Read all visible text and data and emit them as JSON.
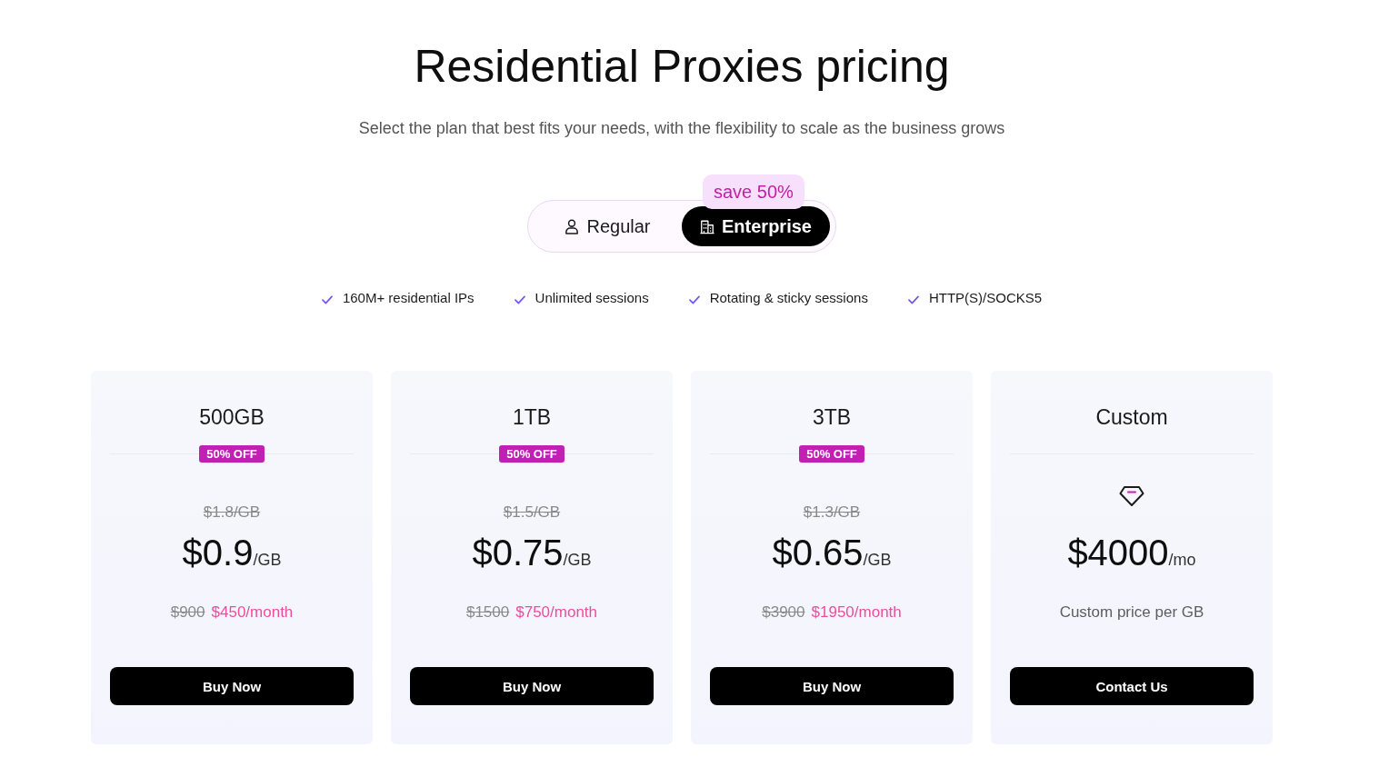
{
  "header": {
    "title": "Residential Proxies pricing",
    "subtitle": "Select the plan that best fits your needs, with the flexibility to scale as the business grows"
  },
  "plan_toggle": {
    "badge": "save 50%",
    "options": [
      {
        "label": "Regular",
        "selected": false
      },
      {
        "label": "Enterprise",
        "selected": true
      }
    ]
  },
  "features": [
    "160M+ residential IPs",
    "Unlimited sessions",
    "Rotating & sticky sessions",
    "HTTP(S)/SOCKS5"
  ],
  "plans": [
    {
      "kind": "discount",
      "name": "500GB",
      "badge": "50% OFF",
      "old_unit_price": "$1.8/GB",
      "price": "$0.9",
      "unit": "/GB",
      "old_monthly": "$900",
      "monthly": "$450/month",
      "button": "Buy Now"
    },
    {
      "kind": "discount",
      "name": "1TB",
      "badge": "50% OFF",
      "old_unit_price": "$1.5/GB",
      "price": "$0.75",
      "unit": "/GB",
      "old_monthly": "$1500",
      "monthly": "$750/month",
      "button": "Buy Now"
    },
    {
      "kind": "discount",
      "name": "3TB",
      "badge": "50% OFF",
      "old_unit_price": "$1.3/GB",
      "price": "$0.65",
      "unit": "/GB",
      "old_monthly": "$3900",
      "monthly": "$1950/month",
      "button": "Buy Now"
    },
    {
      "kind": "custom",
      "name": "Custom",
      "price": "$4000",
      "unit": "/mo",
      "note": "Custom price per GB",
      "button": "Contact Us"
    }
  ]
}
